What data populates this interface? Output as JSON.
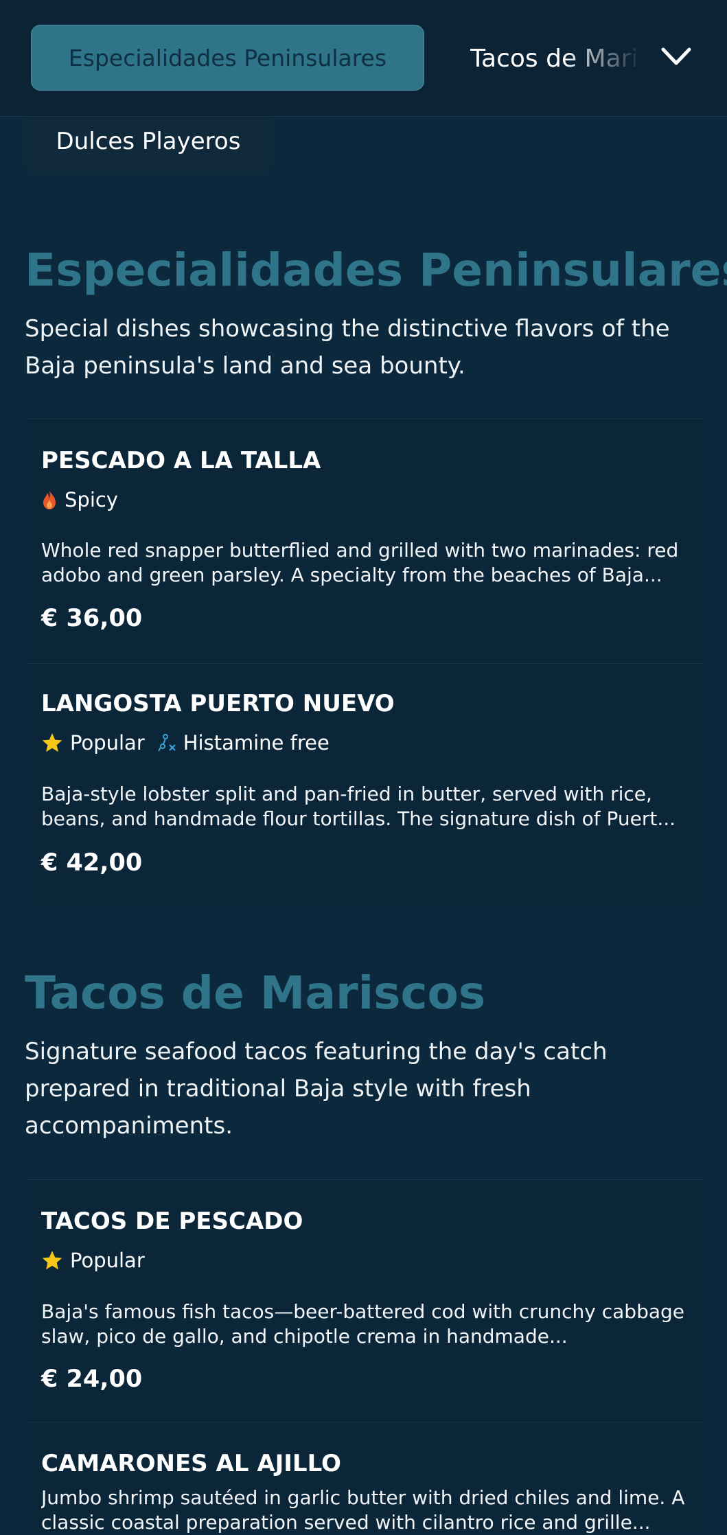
{
  "nav": {
    "active_category": "Especialidades Peninsulares",
    "next_category": "Tacos de Mariscos",
    "wrapped_category": "Dulces Playeros"
  },
  "sections": [
    {
      "title": "Especialidades Peninsulares",
      "description": "Special dishes showcasing the distinctive flavors of the Baja peninsula's land and sea bounty.",
      "items": [
        {
          "name": "PESCADO A LA TALLA",
          "tags": [
            {
              "icon": "flame-icon",
              "label": "Spicy",
              "color": "#e8582b"
            }
          ],
          "description": "Whole red snapper butterflied and grilled with two marinades: red adobo and green parsley. A specialty from the beaches of Baja...",
          "price": "€ 36,00"
        },
        {
          "name": "LANGOSTA PUERTO NUEVO",
          "tags": [
            {
              "icon": "star-icon",
              "label": "Popular",
              "color": "#f5c518"
            },
            {
              "icon": "histamine-free-icon",
              "label": "Histamine free",
              "color": "#3aa0d8"
            }
          ],
          "description": "Baja-style lobster split and pan-fried in butter, served with rice, beans, and handmade flour tortillas. The signature dish of Puert...",
          "price": "€ 42,00"
        }
      ]
    },
    {
      "title": "Tacos de Mariscos",
      "description": "Signature seafood tacos featuring the day's catch prepared in traditional Baja style with fresh accompaniments.",
      "items": [
        {
          "name": "TACOS DE PESCADO",
          "tags": [
            {
              "icon": "star-icon",
              "label": "Popular",
              "color": "#f5c518"
            }
          ],
          "description": "Baja's famous fish tacos—beer-battered cod with crunchy cabbage slaw, pico de gallo, and chipotle crema in handmade...",
          "price": "€ 24,00"
        },
        {
          "name": "CAMARONES AL AJILLO",
          "description": "Jumbo shrimp sautéed in garlic butter with dried chiles and lime. A classic coastal preparation served with cilantro rice and grille..."
        }
      ]
    }
  ]
}
